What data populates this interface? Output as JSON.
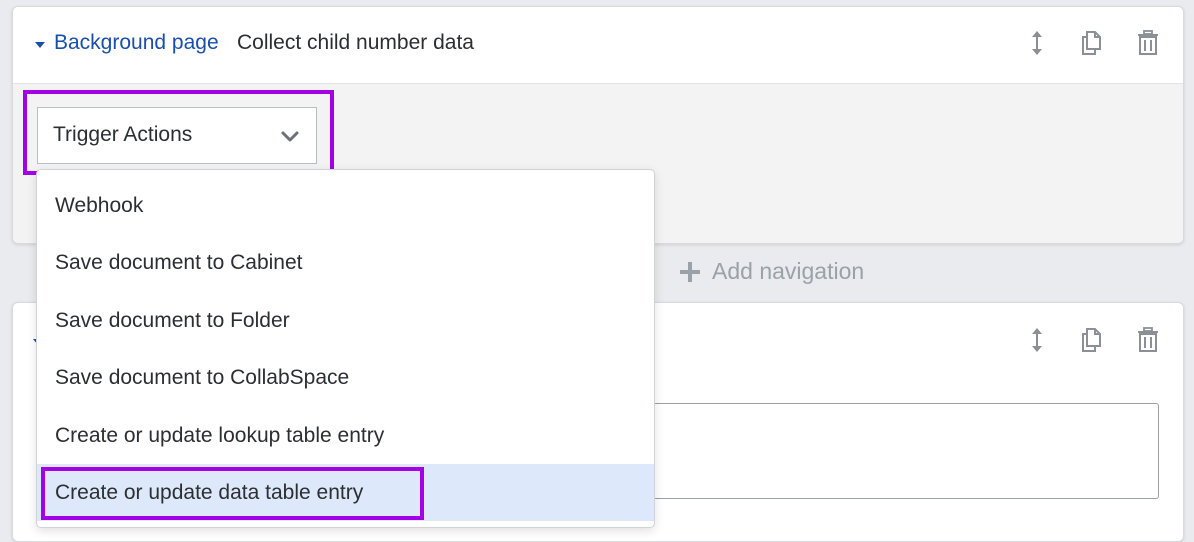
{
  "card1": {
    "section_link": "Background page",
    "section_title": "Collect child number data"
  },
  "select": {
    "value": "Trigger Actions"
  },
  "dropdown": {
    "options": [
      "Webhook",
      "Save document to Cabinet",
      "Save document to Folder",
      "Save document to CollabSpace",
      "Create or update lookup table entry",
      "Create or update data table entry"
    ],
    "highlighted_index": 5
  },
  "add_navigation_label": "Add navigation",
  "colors": {
    "link": "#1a4fa8",
    "highlight_border": "#a300e6",
    "active_option_bg": "#dde9fa",
    "icon_gray": "#8a9096"
  },
  "icons": {
    "card1": [
      "move-icon",
      "duplicate-icon",
      "delete-icon"
    ],
    "card2": [
      "move-icon",
      "duplicate-icon",
      "delete-icon"
    ]
  }
}
